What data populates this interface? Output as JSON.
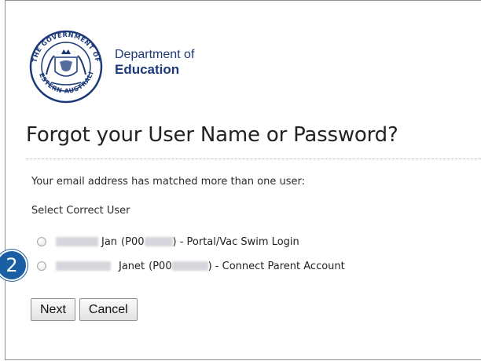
{
  "logo": {
    "line1": "Department of",
    "line2": "Education",
    "seal_text": "THE GOVERNMENT OF WESTERN AUSTRALIA"
  },
  "page": {
    "title": "Forgot your User Name or Password?",
    "message": "Your email address has matched more than one user:",
    "select_label": "Select Correct User"
  },
  "users": [
    {
      "name": "Jan",
      "id_prefix": "(P00",
      "suffix": ") - Portal/Vac Swim Login"
    },
    {
      "name": "Janet",
      "id_prefix": "(P00",
      "suffix": ") - Connect Parent Account"
    }
  ],
  "buttons": {
    "next": "Next",
    "cancel": "Cancel"
  },
  "step_badge": "2",
  "colors": {
    "badge": "#1a5fa3",
    "logo_text": "#1c3a7a"
  }
}
